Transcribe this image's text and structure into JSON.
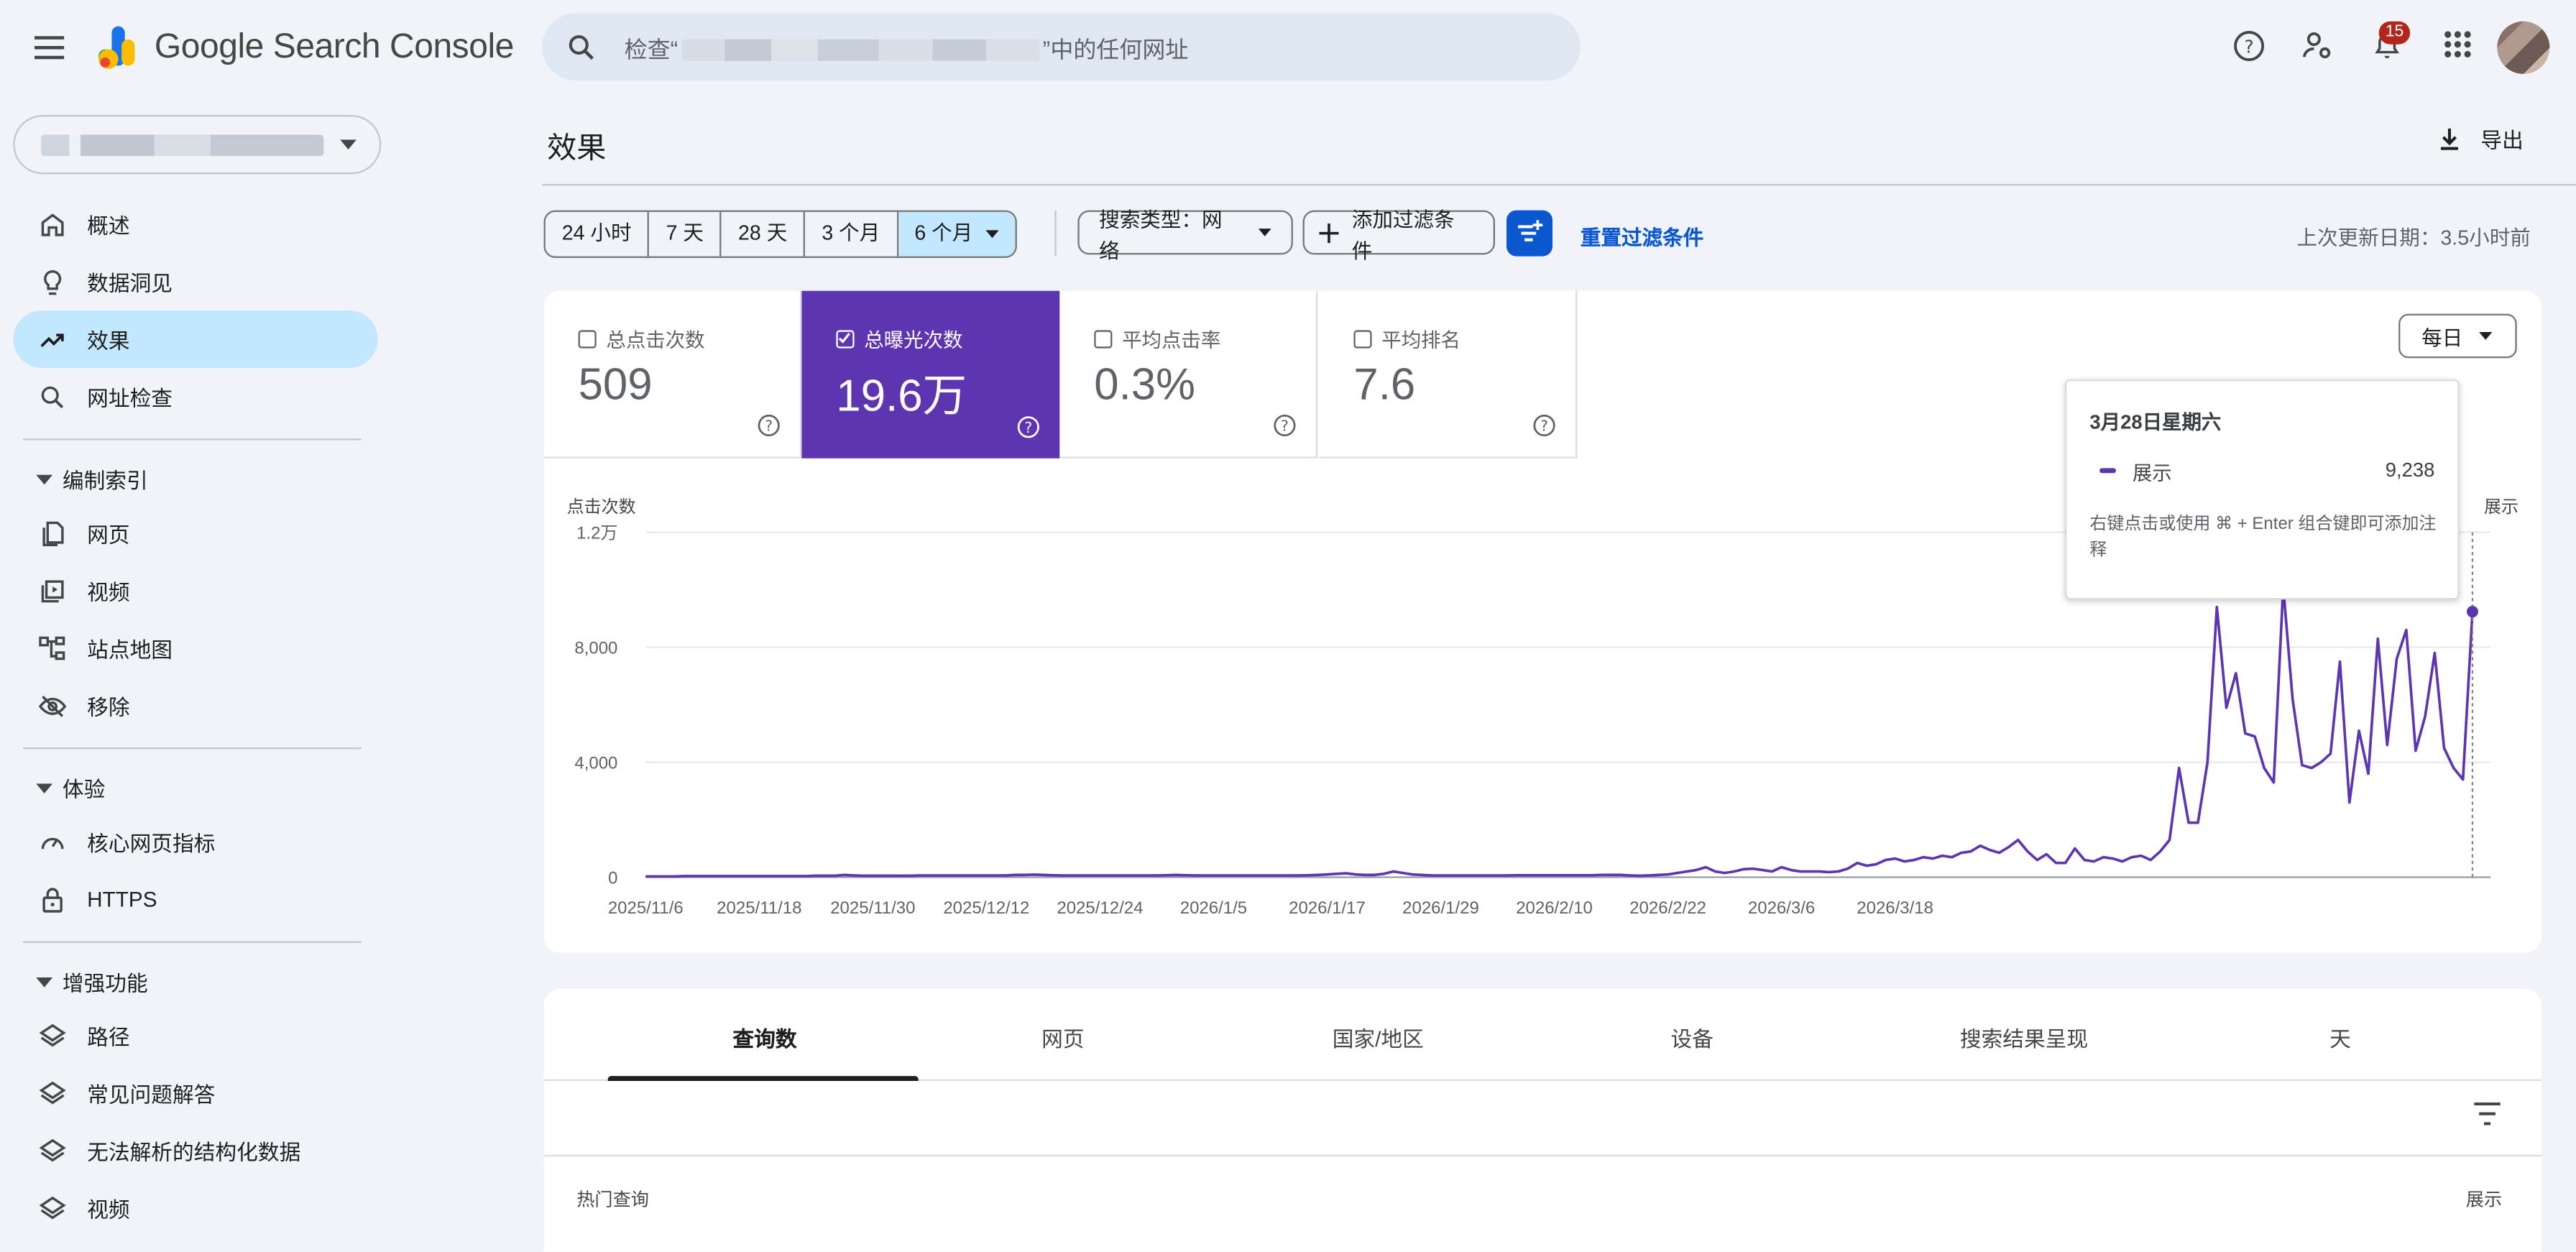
{
  "app": {
    "title": "Google Search Console"
  },
  "search": {
    "prefix": "检查“",
    "suffix": "”中的任何网址"
  },
  "header": {
    "notification_count": "15"
  },
  "sidebar": {
    "items": [
      {
        "label": "概述"
      },
      {
        "label": "数据洞见"
      },
      {
        "label": "效果"
      },
      {
        "label": "网址检查"
      }
    ],
    "sections": [
      {
        "label": "编制索引",
        "items": [
          {
            "label": "网页"
          },
          {
            "label": "视频"
          },
          {
            "label": "站点地图"
          },
          {
            "label": "移除"
          }
        ]
      },
      {
        "label": "体验",
        "items": [
          {
            "label": "核心网页指标"
          },
          {
            "label": "HTTPS"
          }
        ]
      },
      {
        "label": "增强功能",
        "items": [
          {
            "label": "路径"
          },
          {
            "label": "常见问题解答"
          },
          {
            "label": "无法解析的结构化数据"
          },
          {
            "label": "视频"
          }
        ]
      }
    ]
  },
  "main": {
    "title": "效果",
    "export_label": "导出",
    "date_ranges": [
      "24 小时",
      "7 天",
      "28 天",
      "3 个月",
      "6 个月"
    ],
    "search_type_label": "搜索类型：网络",
    "add_filter_label": "添加过滤条件",
    "reset_label": "重置过滤条件",
    "updated_label": "上次更新日期：3.5小时前"
  },
  "metrics": [
    {
      "label": "总点击次数",
      "value": "509",
      "checked": false
    },
    {
      "label": "总曝光次数",
      "value": "19.6万",
      "checked": true
    },
    {
      "label": "平均点击率",
      "value": "0.3%",
      "checked": false
    },
    {
      "label": "平均排名",
      "value": "7.6",
      "checked": false
    }
  ],
  "granularity_label": "每日",
  "tooltip": {
    "date": "3月28日星期六",
    "series": "展示",
    "value": "9,238",
    "hint": "右键点击或使用 ⌘ + Enter 组合键即可添加注释"
  },
  "chart_data": {
    "type": "line",
    "ylabel_left": "点击次数",
    "ylabel_right": "展示",
    "yticks": [
      "0",
      "4,000",
      "8,000",
      "1.2万"
    ],
    "ylim": [
      0,
      12000
    ],
    "xticks": [
      "2025/11/6",
      "2025/11/18",
      "2025/11/30",
      "2025/12/12",
      "2025/12/24",
      "2026/1/5",
      "2026/1/17",
      "2026/1/29",
      "2026/2/10",
      "2026/2/22",
      "2026/3/6",
      "2026/3/18"
    ],
    "series": [
      {
        "name": "展示",
        "color": "#5e35b1",
        "start": "2025/11/6",
        "values": [
          30,
          30,
          30,
          30,
          40,
          40,
          40,
          40,
          40,
          40,
          40,
          40,
          40,
          40,
          40,
          40,
          40,
          40,
          50,
          50,
          50,
          80,
          60,
          50,
          50,
          50,
          50,
          50,
          50,
          60,
          60,
          60,
          60,
          60,
          60,
          60,
          60,
          60,
          60,
          80,
          80,
          90,
          80,
          70,
          60,
          60,
          60,
          60,
          60,
          60,
          60,
          60,
          60,
          60,
          60,
          70,
          80,
          70,
          60,
          60,
          60,
          60,
          60,
          60,
          60,
          60,
          60,
          60,
          60,
          60,
          70,
          80,
          100,
          120,
          140,
          100,
          80,
          80,
          120,
          200,
          150,
          100,
          80,
          60,
          60,
          60,
          60,
          60,
          60,
          60,
          60,
          60,
          70,
          70,
          70,
          70,
          70,
          70,
          70,
          70,
          70,
          80,
          80,
          80,
          60,
          50,
          60,
          80,
          100,
          150,
          200,
          250,
          350,
          200,
          150,
          200,
          280,
          300,
          250,
          200,
          350,
          250,
          200,
          200,
          200,
          180,
          200,
          300,
          500,
          400,
          450,
          600,
          650,
          550,
          600,
          700,
          650,
          750,
          700,
          850,
          900,
          1100,
          950,
          850,
          1050,
          1300,
          900,
          600,
          800,
          500,
          500,
          1000,
          600,
          550,
          700,
          650,
          550,
          700,
          750,
          600,
          900,
          1300,
          3800,
          1900,
          1900,
          4000,
          9400,
          5900,
          7100,
          5000,
          4900,
          3800,
          3300,
          10100,
          6200,
          3900,
          3800,
          4000,
          4300,
          7500,
          2600,
          5100,
          3600,
          8300,
          4600,
          7600,
          8600,
          4400,
          5600,
          7800,
          4500,
          3800,
          3400,
          9238
        ]
      }
    ]
  },
  "bottom": {
    "tabs": [
      "查询数",
      "网页",
      "国家/地区",
      "设备",
      "搜索结果呈现",
      "天"
    ],
    "table_header_left": "热门查询",
    "table_header_right": "展示"
  }
}
